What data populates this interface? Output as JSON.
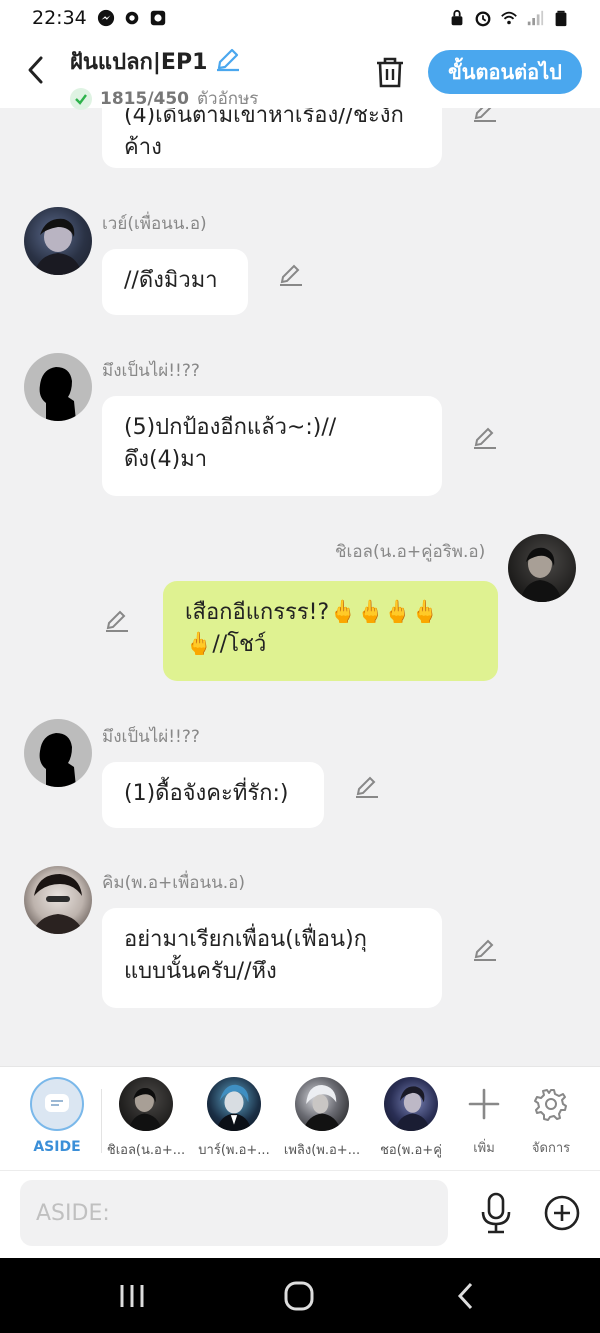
{
  "status_bar": {
    "time": "22:34",
    "left_icons": [
      "messenger-icon",
      "gear-icon",
      "screen-record-icon"
    ],
    "right_icons": [
      "lock-icon",
      "alarm-icon",
      "wifi-icon",
      "signal-icon",
      "battery-icon"
    ]
  },
  "header": {
    "title": "ฝันแปลก|EP1",
    "char_count": "1815/450",
    "char_unit": "ตัวอักษร",
    "next_label": "ขั้นตอนต่อไป"
  },
  "messages": [
    {
      "sender": "",
      "text": "(4)เดินตามเขาหาเรื่อง//ชะงักค้าง"
    },
    {
      "sender": "เวย์(เพื่อนน.อ)",
      "text": "//ดึงมิวมา"
    },
    {
      "sender": "มึงเป็นไผ่!!??",
      "text": "(5)ปกป้องอีกแล้ว~:)//ดึง(4)มา"
    },
    {
      "sender": "ชิเอล(น.อ+คู่อริพ.อ)",
      "text": "เสือกอีแกรรร!?🖕🖕🖕🖕🖕//โชว์"
    },
    {
      "sender": "มึงเป็นไผ่!!??",
      "text": "(1)ดื้อจังคะที่รัก:)"
    },
    {
      "sender": "คิม(พ.อ+เพื่อนน.อ)",
      "text": "อย่ามาเรียกเพื่อน(เฟื่อน)กูแบบนั้นครับ//หึง"
    }
  ],
  "message_lines": {
    "m0_l1": "(4)เดินตามเขาหาเรื่อง//ชะงัก",
    "m0_l2": "ค้าง",
    "m2_l1": "(5)ปกป้องอีกแล้ว~:)//",
    "m2_l2": "ดึง(4)มา",
    "m3_l1": "เสือกอีแกรรร!?🖕🖕🖕🖕",
    "m3_l2": "🖕//โชว์",
    "m5_l1": "อย่ามาเรียกเพื่อน(เฟื่อน)กุ",
    "m5_l2": "แบบนั้นครับ//หึง"
  },
  "characters": [
    {
      "label": "ASIDE"
    },
    {
      "label": "ชิเอล(น.อ+..."
    },
    {
      "label": "บาร์(พ.อ+..."
    },
    {
      "label": "เพลิง(พ.อ+..."
    },
    {
      "label": "ชอ(พ.อ+คู่"
    }
  ],
  "tools": {
    "add_label": "เพิ่ม",
    "manage_label": "จัดการ"
  },
  "input": {
    "placeholder": "ASIDE:"
  },
  "colors": {
    "accent": "#4aa7ee",
    "mine_bubble": "#dff291",
    "background": "#f1f1f2"
  }
}
